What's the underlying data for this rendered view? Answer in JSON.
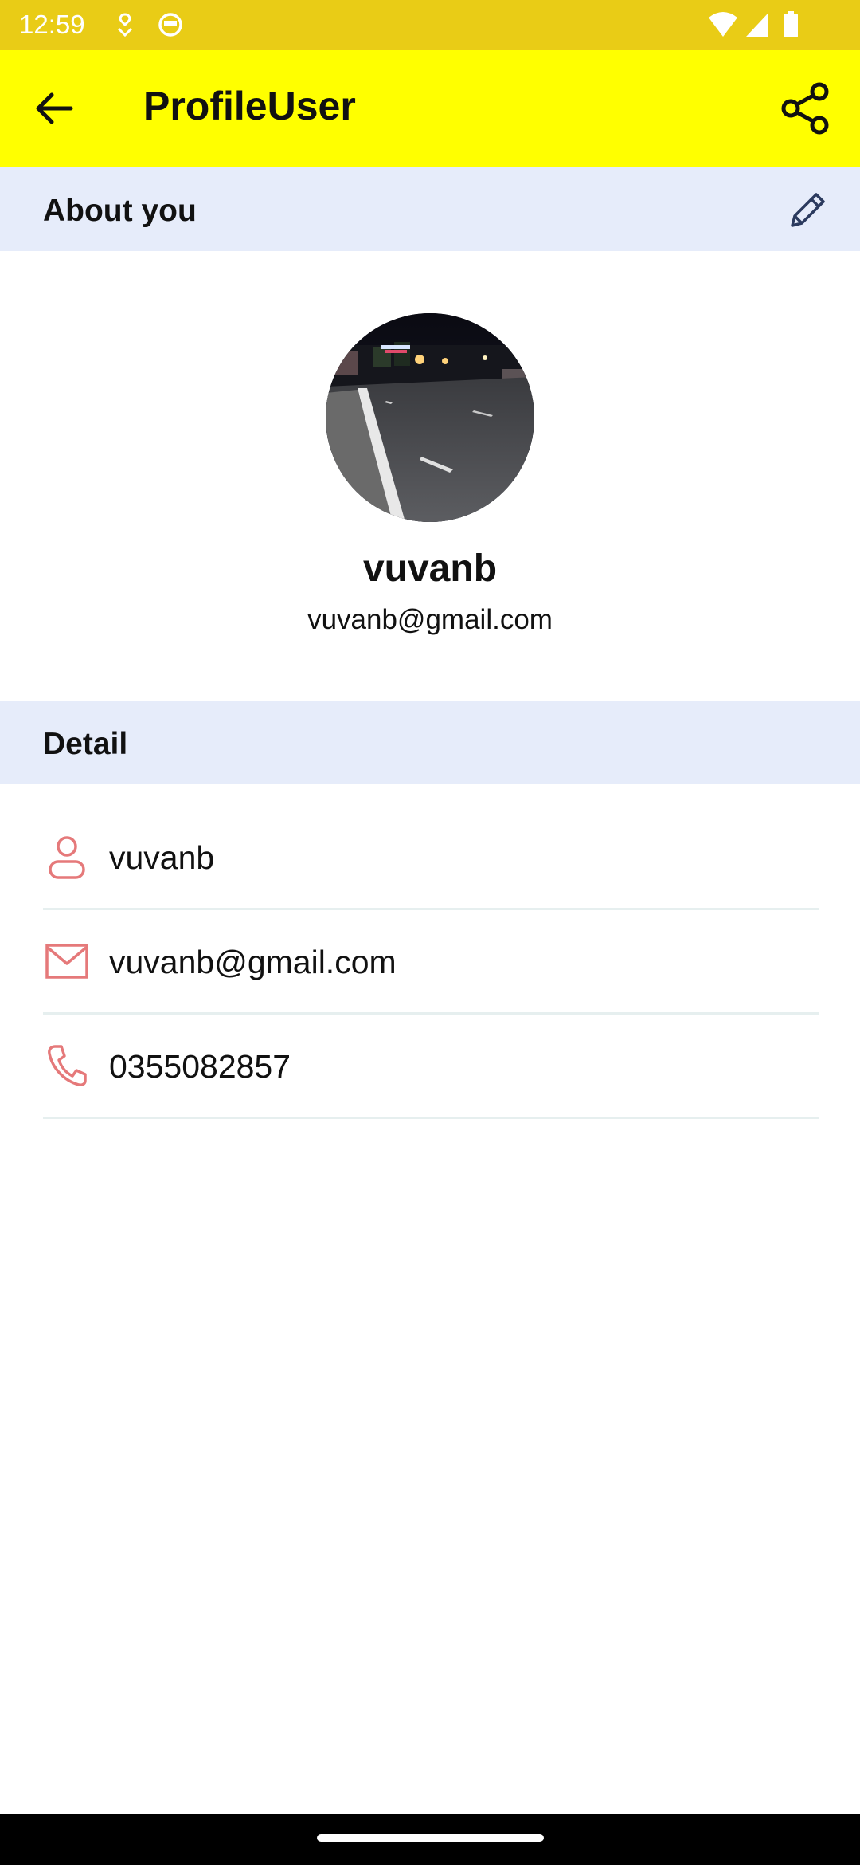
{
  "status_bar": {
    "time": "12:59",
    "icons": [
      "vpn-icon",
      "face-icon",
      "wifi-icon",
      "signal-icon",
      "battery-icon"
    ]
  },
  "app_bar": {
    "title": "ProfileUser",
    "back_icon": "arrow-left-icon",
    "share_icon": "share-icon",
    "background": "#FFFF00"
  },
  "about_section": {
    "title": "About you",
    "edit_icon": "pencil-icon"
  },
  "profile": {
    "name": "vuvanb",
    "email": "vuvanb@gmail.com"
  },
  "detail_section": {
    "title": "Detail",
    "rows": [
      {
        "icon": "user-icon",
        "value": "vuvanb"
      },
      {
        "icon": "mail-icon",
        "value": "vuvanb@gmail.com"
      },
      {
        "icon": "phone-icon",
        "value": "0355082857"
      }
    ]
  },
  "colors": {
    "status_bar": "#E9CC16",
    "app_bar": "#FFFF00",
    "section_header": "#E6ECFA",
    "detail_icon": "#E5797A",
    "divider": "#E6EFEF"
  }
}
